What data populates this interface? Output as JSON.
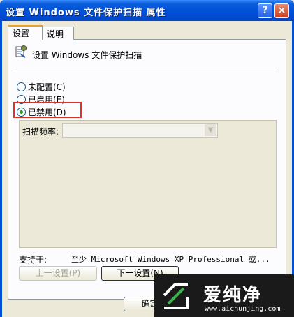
{
  "window": {
    "title": "设置 Windows 文件保护扫描 属性",
    "help_label": "?",
    "close_label": "×"
  },
  "tabs": [
    {
      "label": "设置",
      "active": true
    },
    {
      "label": "说明",
      "active": false
    }
  ],
  "policy": {
    "icon": "policy-setting-icon",
    "title": "设置 Windows 文件保护扫描"
  },
  "radios": [
    {
      "label": "未配置(C)",
      "checked": false
    },
    {
      "label": "已启用(E)",
      "checked": false
    },
    {
      "label": "已禁用(D)",
      "checked": true
    }
  ],
  "options": {
    "scan_frequency_label": "扫描频率:",
    "scan_frequency_value": ""
  },
  "support": {
    "label": "支持于:",
    "value": "至少 Microsoft Windows XP Professional 或..."
  },
  "buttons": {
    "prev": "上一设置(P)",
    "next": "下一设置(N)",
    "ok": "确定"
  },
  "watermark": {
    "name": "爱纯净",
    "url": "www.aichunjing.com"
  },
  "colors": {
    "title_bar": "#0050d8",
    "dialog_bg": "#ece9d8",
    "highlight": "#d9322a"
  }
}
